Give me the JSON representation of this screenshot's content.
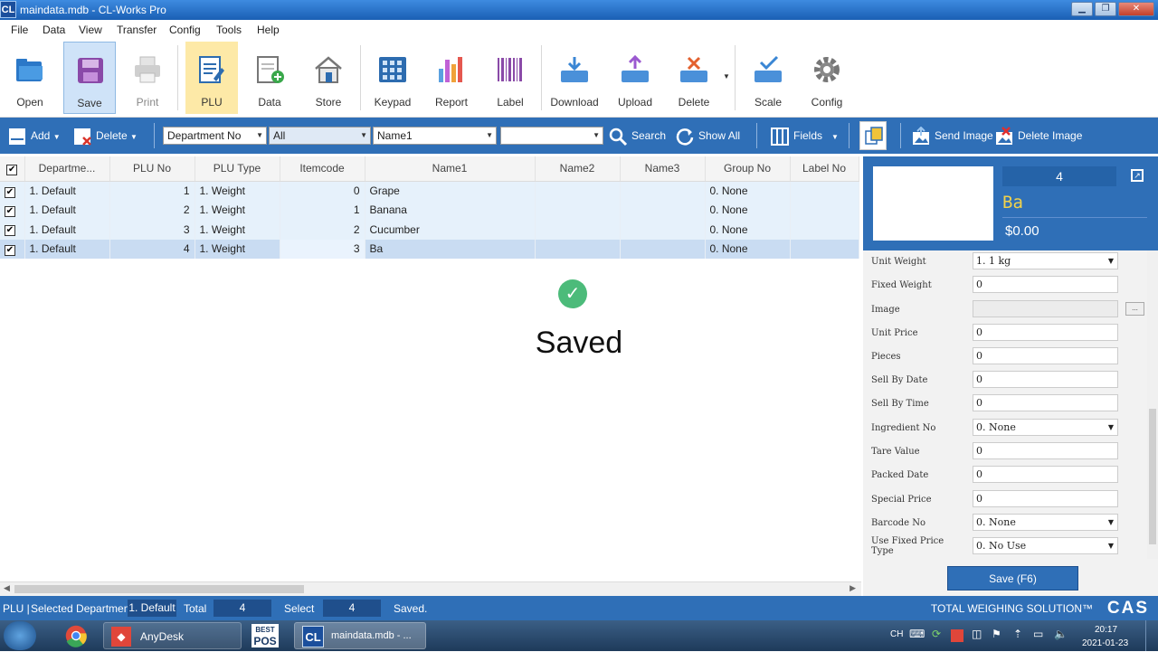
{
  "window": {
    "icon_text": "CL",
    "title": "maindata.mdb - CL-Works Pro",
    "min": "▁",
    "max": "❐",
    "close": "✕"
  },
  "menu": [
    "File",
    "Data",
    "View",
    "Transfer",
    "Config",
    "Tools",
    "Help"
  ],
  "ribbon": {
    "open": "Open",
    "save": "Save",
    "print": "Print",
    "plu": "PLU",
    "data": "Data",
    "store": "Store",
    "keypad": "Keypad",
    "report": "Report",
    "label": "Label",
    "download": "Download",
    "upload": "Upload",
    "delete": "Delete",
    "scale": "Scale",
    "config": "Config"
  },
  "toolbar": {
    "add": "Add",
    "delete": "Delete",
    "filter_field": "Department No",
    "filter_value": "All",
    "name_field": "Name1",
    "search_value": "",
    "search": "Search",
    "show_all": "Show All",
    "fields": "Fields",
    "send_image": "Send Image",
    "delete_image": "Delete Image"
  },
  "grid": {
    "columns": [
      "Departme...",
      "PLU No",
      "PLU Type",
      "Itemcode",
      "Name1",
      "Name2",
      "Name3",
      "Group No",
      "Label No"
    ],
    "rows": [
      {
        "dept": "1. Default",
        "plu": "1",
        "type": "1. Weight",
        "itemcode": "0",
        "name1": "Grape",
        "name2": "",
        "name3": "",
        "group": "0. None",
        "label": ""
      },
      {
        "dept": "1. Default",
        "plu": "2",
        "type": "1. Weight",
        "itemcode": "1",
        "name1": "Banana",
        "name2": "",
        "name3": "",
        "group": "0. None",
        "label": ""
      },
      {
        "dept": "1. Default",
        "plu": "3",
        "type": "1. Weight",
        "itemcode": "2",
        "name1": "Cucumber",
        "name2": "",
        "name3": "",
        "group": "0. None",
        "label": ""
      },
      {
        "dept": "1. Default",
        "plu": "4",
        "type": "1. Weight",
        "itemcode": "3",
        "name1": "Ba",
        "name2": "",
        "name3": "",
        "group": "0. None",
        "label": ""
      }
    ]
  },
  "toast": {
    "text": "Saved"
  },
  "panel": {
    "plu_no": "4",
    "name": "Ba",
    "price": "$0.00",
    "fields": [
      {
        "label": "Unit Weight",
        "value": "1. 1 kg",
        "type": "dropdown"
      },
      {
        "label": "Fixed Weight",
        "value": "0",
        "type": "text"
      },
      {
        "label": "Image",
        "value": "",
        "type": "browse"
      },
      {
        "label": "Unit Price",
        "value": "0",
        "type": "text"
      },
      {
        "label": "Pieces",
        "value": "0",
        "type": "text"
      },
      {
        "label": "Sell By Date",
        "value": "0",
        "type": "text"
      },
      {
        "label": "Sell By Time",
        "value": "0",
        "type": "text"
      },
      {
        "label": "Ingredient No",
        "value": "0. None",
        "type": "dropdown"
      },
      {
        "label": "Tare Value",
        "value": "0",
        "type": "text"
      },
      {
        "label": "Packed Date",
        "value": "0",
        "type": "text"
      },
      {
        "label": "Special Price",
        "value": "0",
        "type": "text"
      },
      {
        "label": "Barcode No",
        "value": "0. None",
        "type": "dropdown"
      },
      {
        "label": "Use Fixed Price Type",
        "value": "0. No Use",
        "type": "dropdown"
      }
    ],
    "browse_label": "...",
    "save_button": "Save (F6)"
  },
  "status": {
    "module": "PLU |",
    "selected_dept_label": "Selected Department",
    "selected_dept": "1. Default",
    "total_label": "Total",
    "total": "4",
    "select_label": "Select",
    "select": "4",
    "message": "Saved.",
    "brand": "TOTAL WEIGHING SOLUTION™",
    "logo": "CAS"
  },
  "taskbar": {
    "anydesk": "AnyDesk",
    "pos": "POS",
    "pos_top": "BEST",
    "clworks": "maindata.mdb - ...",
    "lang": "CH",
    "time": "20:17",
    "date": "2021-01-23"
  },
  "colors": {
    "accent": "#2f6fb7",
    "row": "#e6f1fb",
    "selected_row": "#c9dcf2",
    "name_yellow": "#f2d24a",
    "check_green": "#4cbb7a"
  }
}
